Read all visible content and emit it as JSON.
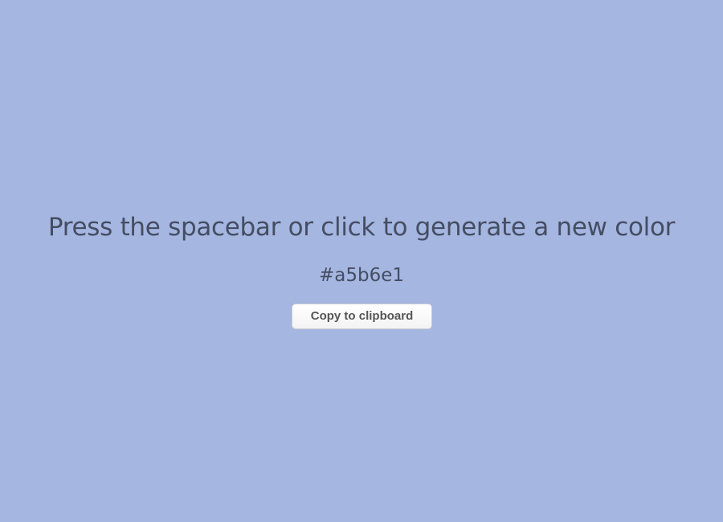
{
  "colors": {
    "background": "#a5b6e1",
    "text": "#454d62"
  },
  "main": {
    "instruction": "Press the spacebar or click to generate a new color",
    "hex_value": "#a5b6e1",
    "copy_button_label": "Copy to clipboard"
  }
}
